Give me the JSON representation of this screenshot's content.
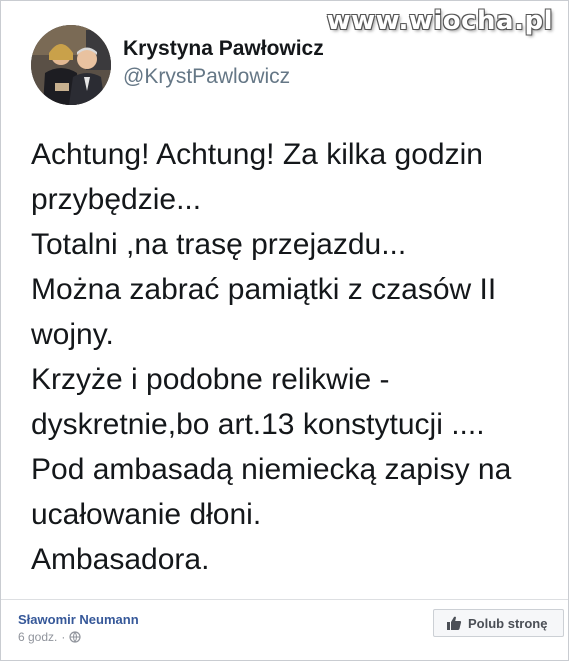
{
  "watermark": "www.wiocha.pl",
  "tweet": {
    "author_name": "Krystyna Pawłowicz",
    "author_handle": "@KrystPawlowicz",
    "lines": [
      "Achtung! Achtung! Za kilka godzin",
      "przybędzie...",
      "Totalni ,na trasę przejazdu...",
      "Można zabrać pamiątki z czasów II",
      "wojny.",
      "Krzyże i podobne relikwie -",
      "dyskretnie,bo art.13 konstytucji ....",
      "Pod ambasadą niemiecką zapisy na",
      "ucałowanie dłoni.",
      "Ambasadora."
    ]
  },
  "fb_post": {
    "author": "Sławomir Neumann",
    "time": "6 godz.",
    "separator": "·",
    "like_page_label": "Polub stronę"
  }
}
